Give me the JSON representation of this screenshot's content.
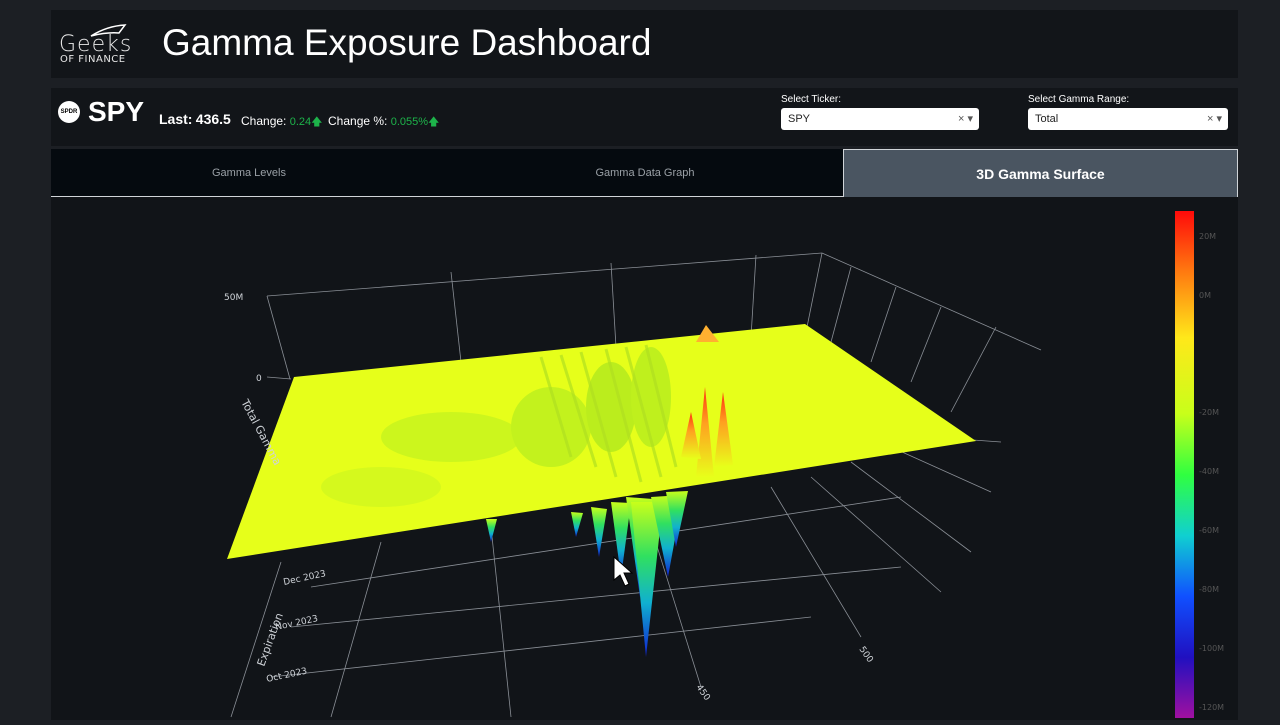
{
  "header": {
    "logo_top": "Geeks",
    "logo_bottom": "OF FINANCE",
    "title": "Gamma Exposure Dashboard"
  },
  "ticker_bar": {
    "symbol": "SPY",
    "badge": "SPDR",
    "last_label": "Last:",
    "last_value": "436.5",
    "change_label": "Change:",
    "change_value": "0.24",
    "change_pct_label": "Change %:",
    "change_pct_value": "0.055%",
    "up_arrow": "🡅",
    "ticker_select_label": "Select Ticker:",
    "ticker_select_value": "SPY",
    "range_select_label": "Select Gamma Range:",
    "range_select_value": "Total",
    "clear_glyph": "×",
    "caret_glyph": "▾"
  },
  "tabs": [
    {
      "label": "Gamma Levels",
      "active": false
    },
    {
      "label": "Gamma Data Graph",
      "active": false
    },
    {
      "label": "3D Gamma Surface",
      "active": true
    }
  ],
  "surface": {
    "z_title": "Total Gamma",
    "z_ticks": [
      "50M",
      "0"
    ],
    "y_title": "Expiration",
    "y_ticks": [
      "Dec 2023",
      "Nov 2023",
      "Oct 2023"
    ],
    "x_ticks": [
      "450",
      "500"
    ],
    "colorbar_ticks": [
      "20M",
      "0M",
      "-20M",
      "-40M",
      "-60M",
      "-80M",
      "-100M",
      "-120M"
    ],
    "colors": {
      "surface": "#e8ff1a",
      "high": "#ff1a0a",
      "low": "#1020d0"
    }
  }
}
